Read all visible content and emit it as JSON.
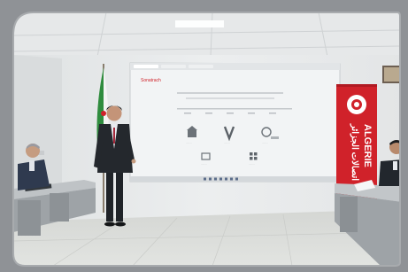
{
  "scene": {
    "description_free": true
  },
  "projection": {
    "app_logo_text": "Sonatrach",
    "tiles": [
      {
        "icon": "building-icon",
        "label": "........"
      },
      {
        "icon": "v-icon",
        "label": "........"
      },
      {
        "icon": "phone-icon",
        "label": "........"
      },
      {
        "icon": "grid-icon",
        "label": "........"
      },
      {
        "icon": "tools-icon",
        "label": "........"
      }
    ]
  },
  "banner": {
    "arabic_text": "اتصالات الجزائر",
    "latin_text": "ALGERIE"
  },
  "colors": {
    "banner_red": "#d0222a",
    "wall": "#e9ebec",
    "floor": "#d9dbd8",
    "screen": "#f4f6f6",
    "frame": "#8f9296"
  }
}
